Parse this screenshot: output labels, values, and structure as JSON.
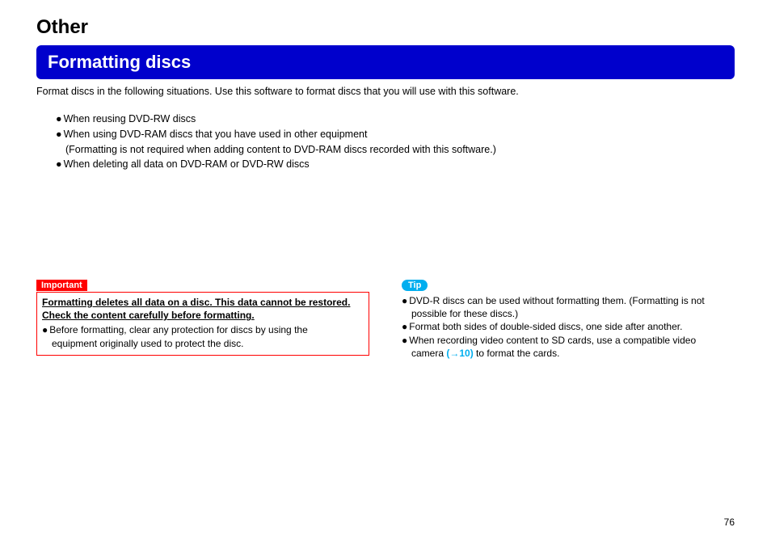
{
  "section": "Other",
  "title": "Formatting discs",
  "intro": "Format discs in the following situations. Use this software to format discs that you will use with this software.",
  "situations": {
    "i1": "When reusing DVD-RW discs",
    "i2": "When using DVD-RAM discs that you have used in other equipment",
    "i2_sub": "(Formatting is not required when adding content to DVD-RAM discs recorded with this software.)",
    "i3": "When deleting all data on DVD-RAM or DVD-RW discs"
  },
  "important": {
    "label": "Important",
    "warning": "Formatting deletes all data on a disc. This data cannot be restored. Check the content carefully before formatting.",
    "b1": "Before formatting, clear any protection for discs by using the",
    "b1_cont": "equipment originally used to protect the disc."
  },
  "tip": {
    "label": "Tip",
    "t1": "DVD-R discs can be used without formatting them. (Formatting is not",
    "t1_cont": "possible for these discs.)",
    "t2": "Format both sides of double-sided discs, one side after another.",
    "t3_a": "When recording video content to SD cards, use a compatible video",
    "t3_b": "camera ",
    "link": "(→10)",
    "t3_c": " to format the cards."
  },
  "page": "76",
  "bullet": "●"
}
